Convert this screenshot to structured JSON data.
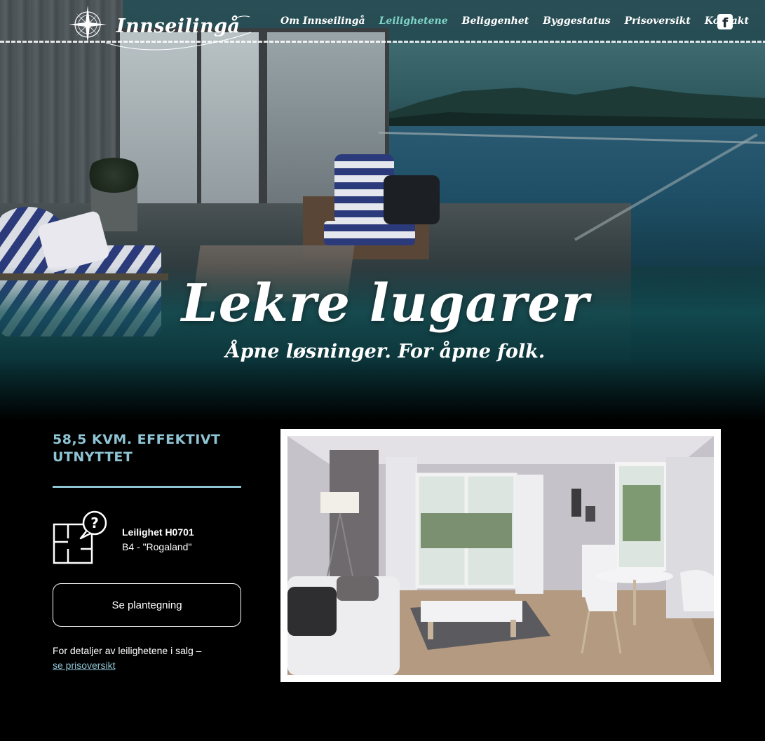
{
  "header": {
    "brand": "Innseilingå",
    "nav": [
      {
        "label": "Om Innseilingå",
        "active": false
      },
      {
        "label": "Leilighetene",
        "active": true
      },
      {
        "label": "Beliggenhet",
        "active": false
      },
      {
        "label": "Byggestatus",
        "active": false
      },
      {
        "label": "Prisoversikt",
        "active": false
      },
      {
        "label": "Kontakt",
        "active": false
      }
    ],
    "social_icon": "facebook-icon"
  },
  "hero": {
    "title": "Lekre lugarer",
    "subtitle": "Åpne løsninger. For åpne folk."
  },
  "apartment": {
    "area_title": "58,5 KVM. EFFEKTIVT UTNYTTET",
    "unit_name": "Leilighet H0701",
    "unit_type": "B4 - \"Rogaland\"",
    "plan_button": "Se plantegning",
    "details_text": "For detaljer av leilighetene i salg  –",
    "details_link": "se prisoversikt"
  },
  "colors": {
    "accent": "#8fc4d4",
    "active_nav": "#7fd3c9",
    "background": "#000000"
  }
}
